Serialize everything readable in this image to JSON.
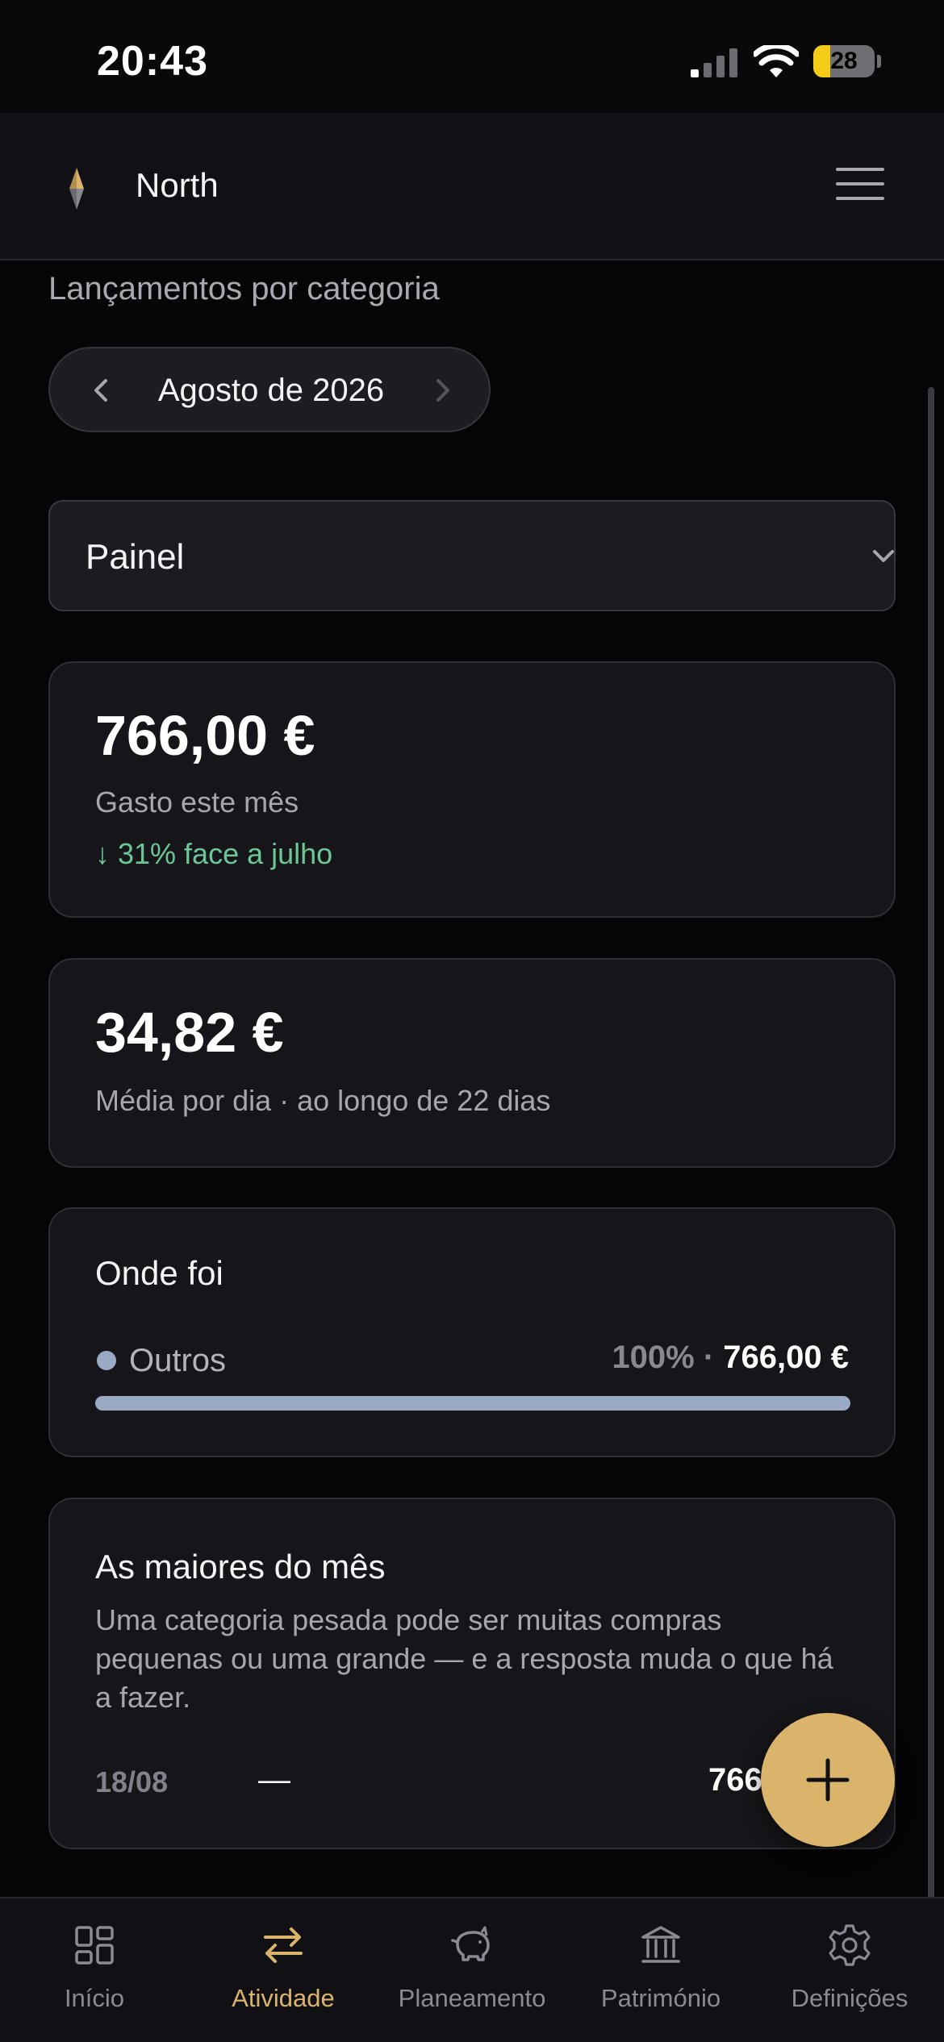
{
  "status_bar": {
    "time": "20:43",
    "battery": "28"
  },
  "header": {
    "app_name": "North"
  },
  "page": {
    "subtitle": "Lançamentos por categoria"
  },
  "month_nav": {
    "label": "Agosto de 2026"
  },
  "view_select": {
    "value": "Painel"
  },
  "spent_card": {
    "amount": "766,00 €",
    "label": "Gasto este mês",
    "trend": "↓ 31% face a julho"
  },
  "daily_card": {
    "amount": "34,82 €",
    "label": "Média por dia · ao longo de 22 dias"
  },
  "where_card": {
    "title": "Onde foi",
    "categories": [
      {
        "name": "Outros",
        "percent_label": "100%",
        "separator": " · ",
        "amount": "766,00 €",
        "share": 1.0,
        "color": "#9aaac4"
      }
    ]
  },
  "top_card": {
    "title": "As maiores do mês",
    "description": "Uma categoria pesada pode ser muitas compras pequenas ou uma grande — e a resposta muda o que há a fazer.",
    "transactions": [
      {
        "date": "18/08",
        "description": "—",
        "amount": "766"
      }
    ]
  },
  "colors": {
    "accent": "#dbb46c",
    "positive": "#6bc795",
    "category": "#9aaac4"
  },
  "tabs": [
    {
      "label": "Início",
      "icon": "grid-icon",
      "active": false
    },
    {
      "label": "Atividade",
      "icon": "arrows-exchange-icon",
      "active": true
    },
    {
      "label": "Planeamento",
      "icon": "piggy-bank-icon",
      "active": false
    },
    {
      "label": "Património",
      "icon": "bank-icon",
      "active": false
    },
    {
      "label": "Definições",
      "icon": "gear-icon",
      "active": false
    }
  ]
}
